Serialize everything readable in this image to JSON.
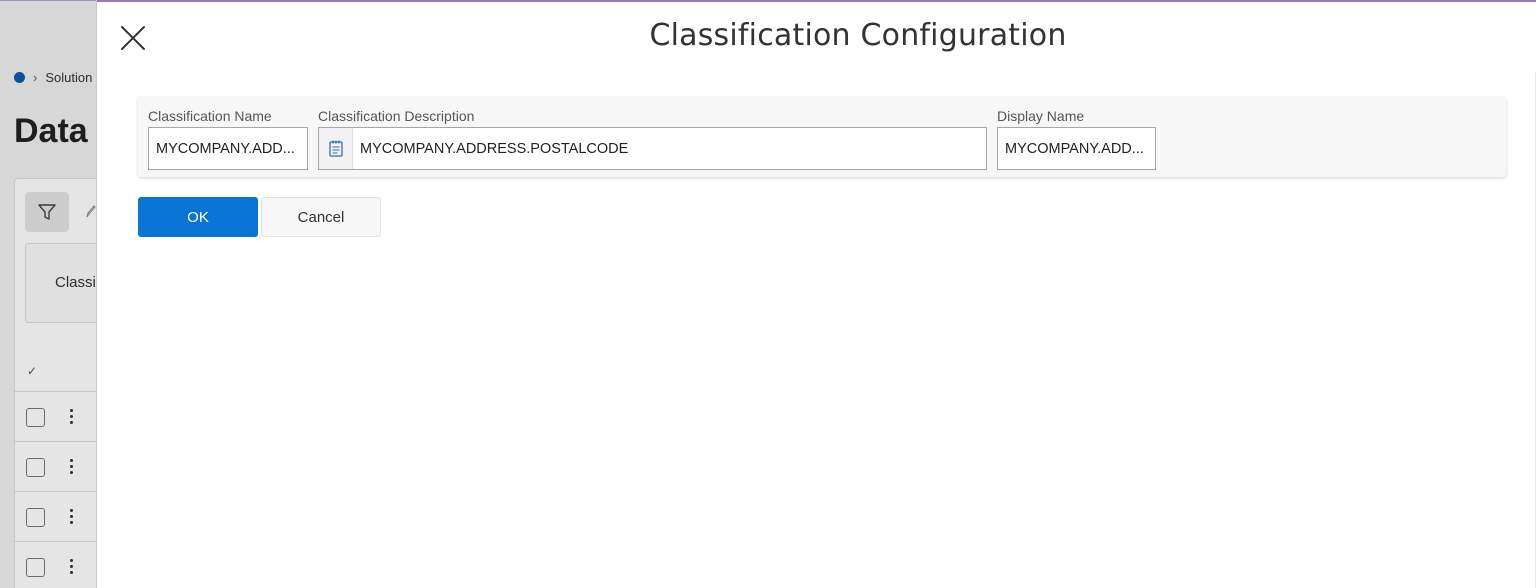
{
  "background": {
    "breadcrumb_item": "Solution",
    "page_title": "Data",
    "filter_label": "Classi",
    "row_count": 4
  },
  "dialog": {
    "title": "Classification Configuration",
    "fields": {
      "classification_name": {
        "label": "Classification Name",
        "value": "MYCOMPANY.ADD..."
      },
      "classification_description": {
        "label": "Classification Description",
        "value": "MYCOMPANY.ADDRESS.POSTALCODE"
      },
      "display_name": {
        "label": "Display Name",
        "value": "MYCOMPANY.ADD..."
      }
    },
    "buttons": {
      "ok": "OK",
      "cancel": "Cancel"
    }
  },
  "colors": {
    "primary": "#0a74d4",
    "icon_blue": "#2f6fb4",
    "title_text": "#333333"
  }
}
